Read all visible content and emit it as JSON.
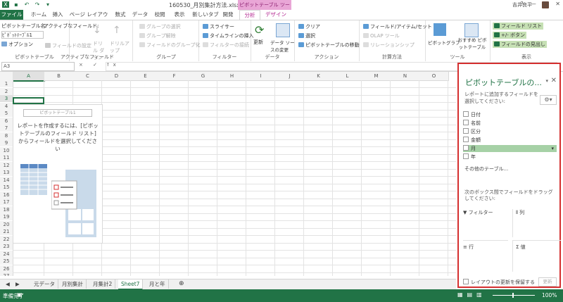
{
  "title_bar": {
    "window_title": "160530_月別集計方法.xlsx - Excel",
    "context_header": "ピボットテーブル ツール",
    "user_name": "吉井良平",
    "controls": [
      "?",
      "—",
      "□",
      "✕"
    ]
  },
  "tabs": [
    "ファイル",
    "ホーム",
    "挿入",
    "ページ レイアウト",
    "数式",
    "データ",
    "校閲",
    "表示",
    "新しいタブ",
    "開発",
    "分析",
    "デザイン"
  ],
  "ribbon": {
    "pivot_name_label": "ピボットテーブル名:",
    "pivot_name_value": "ﾋﾟﾎﾞｯﾄﾃｰﾌﾞﾙ1",
    "active_field_label": "アクティブなフィールド:",
    "options_label": "オプション",
    "field_settings": "フィールドの設定",
    "drill_down": "ドリル ダウン",
    "drill_up": "ドリルアップ",
    "group_selection": "グループの選択",
    "ungroup": "グループ解除",
    "group_field": "フィールドのグループ化",
    "slicer": "スライサー",
    "timeline": "タイムラインの挿入",
    "filter_conn": "フィルターの接続",
    "refresh": "更新",
    "change_source": "データ ソースの変更",
    "clear": "クリア",
    "select": "選択",
    "move_pivot": "ピボットテーブルの移動",
    "fields_items_sets": "フィールド/アイテム/セット",
    "olap_tools": "OLAP ツール",
    "relationships": "リレーションシップ",
    "pivot_chart": "ピボットグラフ",
    "recommended": "おすすめ ピボットテーブル",
    "field_list": "フィールド リスト",
    "buttons": "+/- ボタン",
    "field_headers": "フィールドの見出し",
    "groups": [
      "ピボットテーブル",
      "アクティブなフィールド",
      "グループ",
      "フィルター",
      "データ",
      "アクション",
      "計算方法",
      "ツール",
      "表示"
    ]
  },
  "formula_bar": {
    "name_box": "A3",
    "fx": "× ✓ fx"
  },
  "grid": {
    "columns": [
      "A",
      "B",
      "C",
      "D",
      "E",
      "F",
      "G",
      "H",
      "I",
      "J",
      "K",
      "L",
      "M",
      "N",
      "O"
    ],
    "rows": [
      "1",
      "2",
      "3",
      "4",
      "5",
      "6",
      "7",
      "8",
      "9",
      "10",
      "11",
      "12",
      "13",
      "14",
      "15",
      "16",
      "17",
      "18",
      "19",
      "20",
      "21",
      "22",
      "23",
      "24",
      "25",
      "26",
      "27"
    ]
  },
  "placeholder": {
    "name": "ピボットテーブル1",
    "message": "レポートを作成するには、[ピボットテーブルのフィールド リスト] からフィールドを選択してください"
  },
  "sheets": [
    "元データ",
    "月別集計",
    "月集計2",
    "Sheet7",
    "月と年"
  ],
  "active_sheet_index": 3,
  "status": {
    "ready": "準備完了",
    "zoom": "100%"
  },
  "pane": {
    "title": "ピボットテーブルの...",
    "instructions": "レポートに追加するフィールドを選択してください:",
    "fields": [
      "日付",
      "名前",
      "区分",
      "金額",
      "月",
      "年"
    ],
    "highlighted_field_index": 4,
    "more_tables": "その他のテーブル...",
    "drag_instructions": "次のボックス間でフィールドをドラッグしてください:",
    "areas": {
      "filters": "フィルター",
      "columns": "列",
      "rows": "行",
      "values": "値"
    },
    "defer_update": "レイアウトの更新を保留する",
    "update_button": "更新"
  },
  "colors": {
    "excel_green": "#217346",
    "pane_border": "#d42f2f",
    "context_pink": "#e9a6d6",
    "field_highlight": "#a6d1a6"
  }
}
